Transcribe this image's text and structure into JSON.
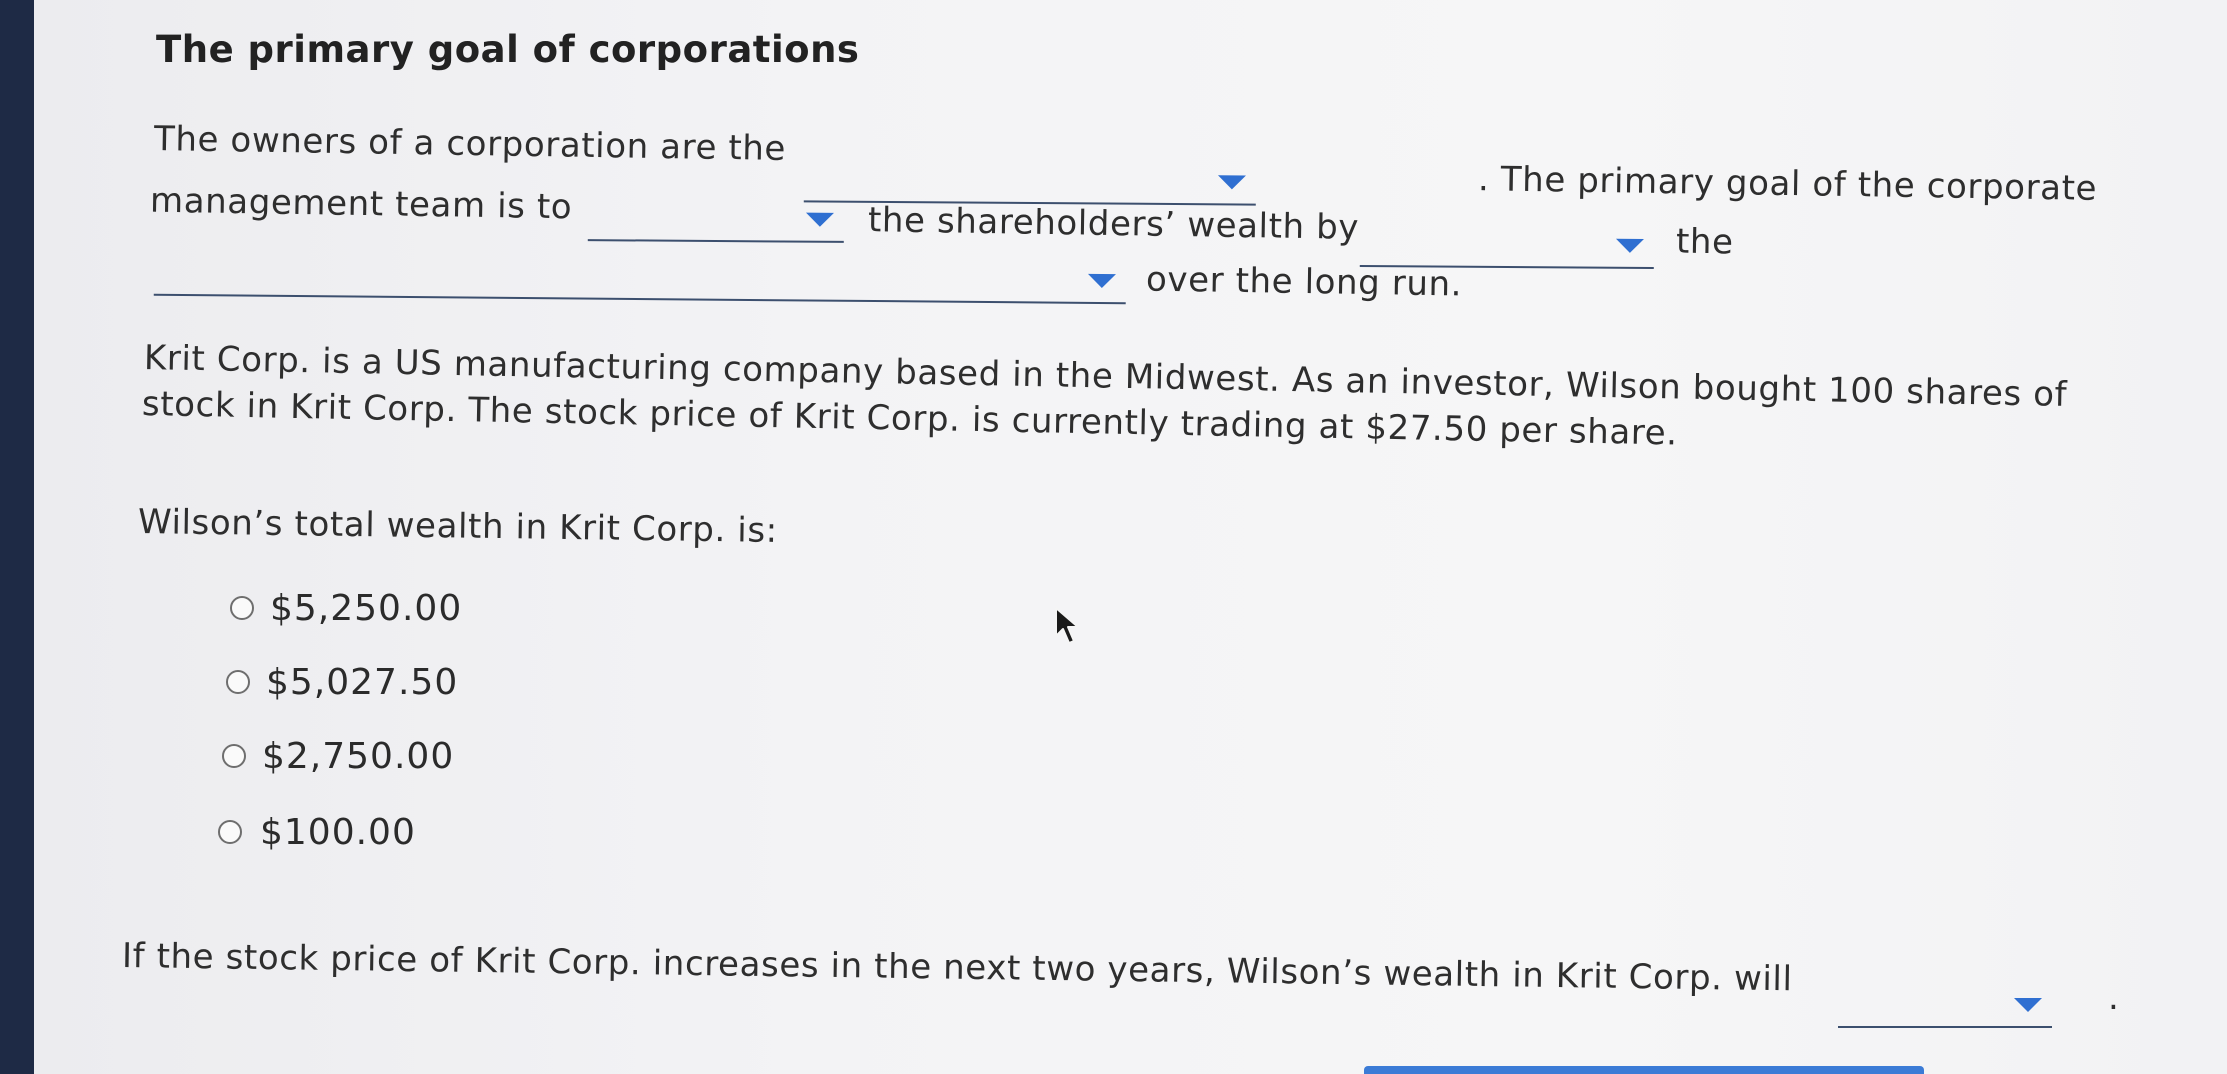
{
  "title": "The primary goal of corporations",
  "para1": {
    "line1_start": "The owners of a corporation are the",
    "line1_end": ". The primary goal of the corporate",
    "line2_start": "management team is to",
    "line2_mid": "the shareholders’ wealth by",
    "line2_end": "the",
    "line3_end": "over the long run."
  },
  "para2": {
    "line1": "Krit Corp. is a US manufacturing company based in the Midwest. As an investor, Wilson bought 100 shares of",
    "line2": "stock in Krit Corp. The stock price of Krit Corp. is currently trading at $27.50 per share."
  },
  "question": "Wilson’s total wealth in Krit Corp. is:",
  "options": [
    "$5,250.00",
    "$5,027.50",
    "$2,750.00",
    "$100.00"
  ],
  "final": {
    "text": "If the stock price of Krit Corp. increases in the next two years, Wilson’s wealth in Krit Corp. will",
    "end": "."
  },
  "icons": {
    "dropdown": "caret-down-icon",
    "pointer": "mouse-pointer-icon"
  },
  "colors": {
    "accent": "#2f6fd1",
    "underline": "#3c4f6e"
  }
}
